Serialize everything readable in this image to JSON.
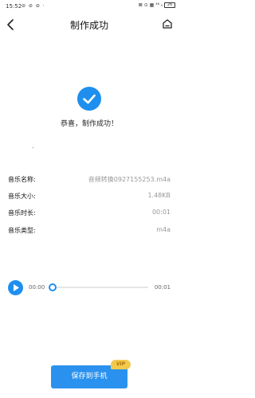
{
  "status_bar": {
    "time": "15:52",
    "left_icons": "⊘ ⊘ ⊘ ·",
    "right_indicators": "⊠ ⊙ ▦ ⁴⁶ ᵢₗ",
    "battery": "26"
  },
  "nav": {
    "title": "制作成功",
    "back_icon": "chevron-left-icon",
    "home_icon": "home-icon"
  },
  "result": {
    "message": "恭喜，制作成功！"
  },
  "info": {
    "name_label": "音乐名称:",
    "name_value": "音频转换0927155253.m4a",
    "size_label": "音乐大小:",
    "size_value": "1.48KB",
    "duration_label": "音乐时长:",
    "duration_value": "00:01",
    "type_label": "音乐类型:",
    "type_value": "m4a"
  },
  "player": {
    "current_time": "00:00",
    "total_time": "00:01",
    "progress": 0
  },
  "actions": {
    "save_label": "保存到手机",
    "vip_badge": "VIP"
  },
  "colors": {
    "accent": "#1e8fee",
    "vip": "#f2c94c"
  }
}
